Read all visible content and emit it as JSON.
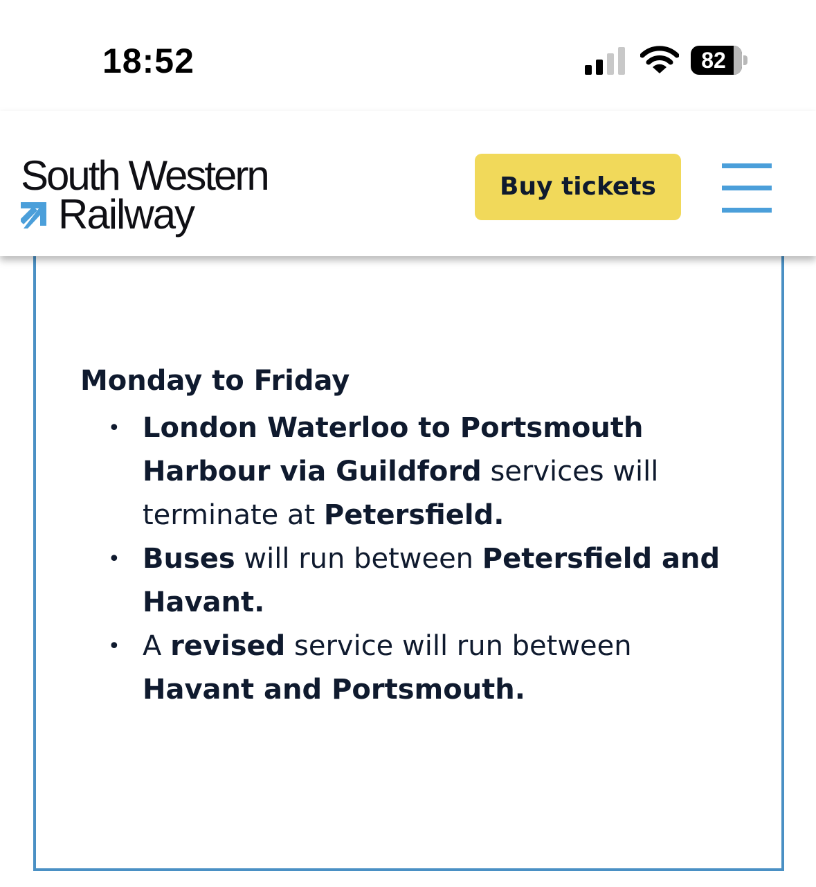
{
  "status_bar": {
    "time": "18:52",
    "battery_level": "82",
    "signal_bars_active": 2,
    "signal_bars_total": 4
  },
  "header": {
    "brand_line1": "South Western",
    "brand_line2": "Railway",
    "buy_tickets_label": "Buy tickets",
    "colors": {
      "button_bg": "#f1d95a",
      "menu_accent": "#4b9fda",
      "logo_accent": "#4b9fda"
    }
  },
  "content": {
    "heading": "Monday to Friday",
    "border_color": "#4a90c4",
    "items": [
      {
        "s1_bold": "London Waterloo to Portsmouth Harbour via Guildford",
        "s2": " services will terminate at ",
        "s3_bold": "Petersfield."
      },
      {
        "s1_bold": "Buses",
        "s2": " will run between ",
        "s3_bold": "Petersfield and Havant."
      },
      {
        "s1": "A ",
        "s2_bold": "revised",
        "s3": " service will run between ",
        "s4_bold": "Havant and Portsmouth."
      }
    ]
  },
  "icons": {
    "signal": "cellular-signal-icon",
    "wifi": "wifi-icon",
    "battery": "battery-icon",
    "logo": "swr-arrow-icon",
    "menu": "hamburger-menu-icon",
    "bullet": "•"
  }
}
